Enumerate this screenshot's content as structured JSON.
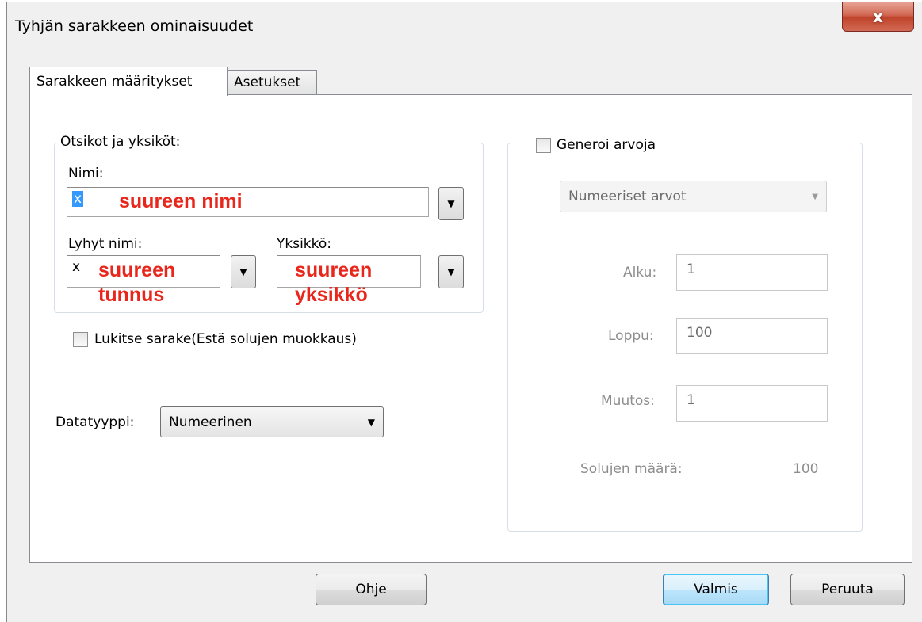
{
  "window": {
    "title": "Tyhjän sarakkeen ominaisuudet",
    "close_label": "x"
  },
  "tabs": [
    {
      "label": "Sarakkeen määritykset",
      "active": true
    },
    {
      "label": "Asetukset",
      "active": false
    }
  ],
  "headings_group": {
    "legend": "Otsikot ja yksiköt:",
    "name_label": "Nimi:",
    "name_value": "x",
    "name_annotation": "suureen nimi",
    "short_name_label": "Lyhyt nimi:",
    "short_name_value": "x",
    "short_name_annotation_line1": "suureen",
    "short_name_annotation_line2": "tunnus",
    "unit_label": "Yksikkö:",
    "unit_value": "",
    "unit_annotation_line1": "suureen",
    "unit_annotation_line2": "yksikkö"
  },
  "lock_column": {
    "label": "Lukitse sarake(Estä solujen muokkaus)",
    "checked": false
  },
  "datatype": {
    "label": "Datatyyppi:",
    "selected": "Numeerinen"
  },
  "generate": {
    "label": "Generoi arvoja",
    "checked": false,
    "mode_selected": "Numeeriset arvot",
    "start_label": "Alku:",
    "start_value": "1",
    "end_label": "Loppu:",
    "end_value": "100",
    "step_label": "Muutos:",
    "step_value": "1",
    "cell_count_label": "Solujen määrä:",
    "cell_count_value": "100"
  },
  "buttons": {
    "help": "Ohje",
    "ok": "Valmis",
    "cancel": "Peruuta"
  },
  "colors": {
    "annotation": "#e8261b",
    "selection": "#3399ff",
    "disabled_text": "#8d8d8d"
  }
}
